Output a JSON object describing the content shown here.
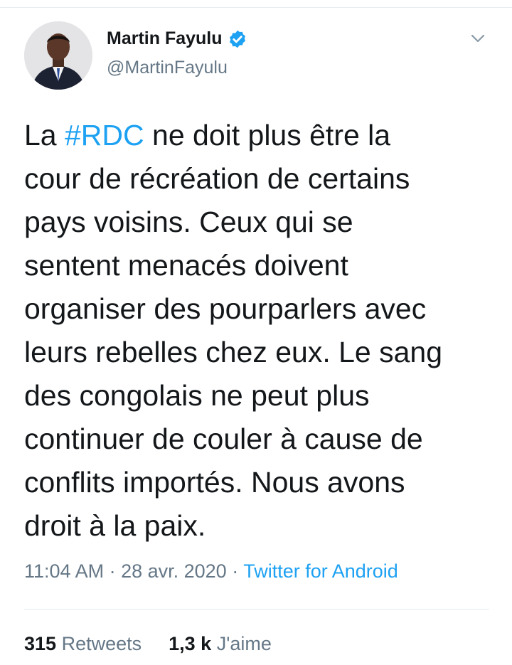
{
  "user": {
    "display_name": "Martin Fayulu",
    "handle": "@MartinFayulu",
    "verified": true
  },
  "tweet": {
    "line1_pre": "La ",
    "hashtag": "#RDC",
    "line1_post": " ne doit plus être la",
    "line2": "cour de récréation de certains",
    "line3": "pays voisins. Ceux qui se",
    "line4": "sentent menacés doivent",
    "line5": "organiser des pourparlers avec",
    "line6": "leurs rebelles chez eux. Le sang",
    "line7": "des congolais ne peut plus",
    "line8": "continuer de couler à cause de",
    "line9": "conflits importés. Nous avons",
    "line10": "droit à la paix."
  },
  "meta": {
    "time": "11:04 AM",
    "separator1": " · ",
    "date": "28 avr. 2020",
    "separator2": " · ",
    "source": "Twitter for Android"
  },
  "stats": {
    "retweets_count": "315",
    "retweets_label": "Retweets",
    "likes_count": "1,3 k",
    "likes_label": "J'aime"
  },
  "icons": {
    "verified": "verified-badge-icon",
    "caret": "chevron-down-icon"
  },
  "colors": {
    "link": "#1da1f2",
    "text": "#14171a",
    "secondary": "#657786",
    "divider": "#e6ecf0"
  }
}
